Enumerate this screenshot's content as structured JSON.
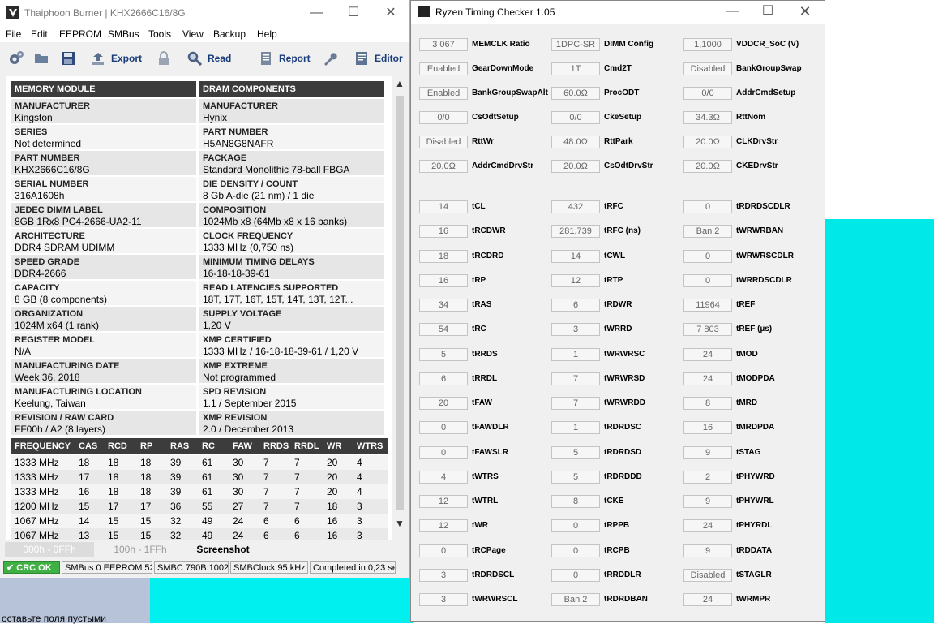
{
  "thaiphoon": {
    "title": "Thaiphoon Burner | KHX2666C16/8G",
    "menu": [
      "File",
      "Edit",
      "EEPROM",
      "SMBus",
      "Tools",
      "View",
      "Backup",
      "Help"
    ],
    "toolbar": {
      "export": "Export",
      "read": "Read",
      "report": "Report",
      "editor": "Editor"
    },
    "headers": {
      "left": "MEMORY MODULE",
      "right": "DRAM COMPONENTS"
    },
    "left_rows": [
      {
        "label": "MANUFACTURER",
        "value": "Kingston"
      },
      {
        "label": "SERIES",
        "value": "Not determined"
      },
      {
        "label": "PART NUMBER",
        "value": "KHX2666C16/8G"
      },
      {
        "label": "SERIAL NUMBER",
        "value": "316A1608h"
      },
      {
        "label": "JEDEC DIMM LABEL",
        "value": "8GB 1Rx8 PC4-2666-UA2-11"
      },
      {
        "label": "ARCHITECTURE",
        "value": "DDR4 SDRAM UDIMM"
      },
      {
        "label": "SPEED GRADE",
        "value": "DDR4-2666"
      },
      {
        "label": "CAPACITY",
        "value": "8 GB (8 components)"
      },
      {
        "label": "ORGANIZATION",
        "value": "1024M x64 (1 rank)"
      },
      {
        "label": "REGISTER MODEL",
        "value": "N/A"
      },
      {
        "label": "MANUFACTURING DATE",
        "value": "Week 36, 2018"
      },
      {
        "label": "MANUFACTURING LOCATION",
        "value": "Keelung, Taiwan"
      },
      {
        "label": "REVISION / RAW CARD",
        "value": "FF00h / A2 (8 layers)"
      }
    ],
    "right_rows": [
      {
        "label": "MANUFACTURER",
        "value": "Hynix"
      },
      {
        "label": "PART NUMBER",
        "value": "H5AN8G8NAFR"
      },
      {
        "label": "PACKAGE",
        "value": "Standard Monolithic 78-ball FBGA"
      },
      {
        "label": "DIE DENSITY / COUNT",
        "value": "8 Gb A-die (21 nm) / 1 die"
      },
      {
        "label": "COMPOSITION",
        "value": "1024Mb x8 (64Mb x8 x 16 banks)"
      },
      {
        "label": "CLOCK FREQUENCY",
        "value": "1333 MHz (0,750 ns)"
      },
      {
        "label": "MINIMUM TIMING DELAYS",
        "value": "16-18-18-39-61"
      },
      {
        "label": "READ LATENCIES SUPPORTED",
        "value": "18T, 17T, 16T, 15T, 14T, 13T, 12T..."
      },
      {
        "label": "SUPPLY VOLTAGE",
        "value": "1,20 V"
      },
      {
        "label": "XMP CERTIFIED",
        "value": "1333 MHz / 16-18-18-39-61 / 1,20 V"
      },
      {
        "label": "XMP EXTREME",
        "value": "Not programmed"
      },
      {
        "label": "SPD REVISION",
        "value": "1.1 / September 2015"
      },
      {
        "label": "XMP REVISION",
        "value": "2.0 / December 2013"
      }
    ],
    "freq_headers": [
      "FREQUENCY",
      "CAS",
      "RCD",
      "RP",
      "RAS",
      "RC",
      "FAW",
      "RRDS",
      "RRDL",
      "WR",
      "WTRS"
    ],
    "freq_rows": [
      [
        "1333 MHz",
        "18",
        "18",
        "18",
        "39",
        "61",
        "30",
        "7",
        "7",
        "20",
        "4"
      ],
      [
        "1333 MHz",
        "17",
        "18",
        "18",
        "39",
        "61",
        "30",
        "7",
        "7",
        "20",
        "4"
      ],
      [
        "1333 MHz",
        "16",
        "18",
        "18",
        "39",
        "61",
        "30",
        "7",
        "7",
        "20",
        "4"
      ],
      [
        "1200 MHz",
        "15",
        "17",
        "17",
        "36",
        "55",
        "27",
        "7",
        "7",
        "18",
        "3"
      ],
      [
        "1067 MHz",
        "14",
        "15",
        "15",
        "32",
        "49",
        "24",
        "6",
        "6",
        "16",
        "3"
      ],
      [
        "1067 MHz",
        "13",
        "15",
        "15",
        "32",
        "49",
        "24",
        "6",
        "6",
        "16",
        "3"
      ]
    ],
    "tabs": [
      "000h - 0FFh",
      "100h - 1FFh",
      "Screenshot"
    ],
    "status": [
      "CRC OK",
      "SMBus 0 EEPROM 52h",
      "SMBC 790B:1002",
      "SMBClock 95 kHz",
      "Completed in 0,23 sec"
    ]
  },
  "rtc": {
    "title": "Ryzen Timing Checker 1.05",
    "rows": [
      [
        {
          "v": "3 067",
          "l": "MEMCLK Ratio"
        },
        {
          "v": "1DPC-SR",
          "l": "DIMM Config"
        },
        {
          "v": "1,1000",
          "l": "VDDCR_SoC (V)"
        }
      ],
      [
        {
          "v": "Enabled",
          "l": "GearDownMode"
        },
        {
          "v": "1T",
          "l": "Cmd2T"
        },
        {
          "v": "Disabled",
          "l": "BankGroupSwap"
        }
      ],
      [
        {
          "v": "Enabled",
          "l": "BankGroupSwapAlt"
        },
        {
          "v": "60.0Ω",
          "l": "ProcODT"
        },
        {
          "v": "0/0",
          "l": "AddrCmdSetup"
        }
      ],
      [
        {
          "v": "0/0",
          "l": "CsOdtSetup"
        },
        {
          "v": "0/0",
          "l": "CkeSetup"
        },
        {
          "v": "34.3Ω",
          "l": "RttNom"
        }
      ],
      [
        {
          "v": "Disabled",
          "l": "RttWr"
        },
        {
          "v": "48.0Ω",
          "l": "RttPark"
        },
        {
          "v": "20.0Ω",
          "l": "CLKDrvStr"
        }
      ],
      [
        {
          "v": "20.0Ω",
          "l": "AddrCmdDrvStr"
        },
        {
          "v": "20.0Ω",
          "l": "CsOdtDrvStr"
        },
        {
          "v": "20.0Ω",
          "l": "CKEDrvStr"
        }
      ],
      [
        {
          "v": "14",
          "l": "tCL"
        },
        {
          "v": "432",
          "l": "tRFC"
        },
        {
          "v": "0",
          "l": "tRDRDSCDLR"
        }
      ],
      [
        {
          "v": "16",
          "l": "tRCDWR"
        },
        {
          "v": "281,739",
          "l": "tRFC (ns)"
        },
        {
          "v": "Ban 2",
          "l": "tWRWRBAN"
        }
      ],
      [
        {
          "v": "18",
          "l": "tRCDRD"
        },
        {
          "v": "14",
          "l": "tCWL"
        },
        {
          "v": "0",
          "l": "tWRWRSCDLR"
        }
      ],
      [
        {
          "v": "16",
          "l": "tRP"
        },
        {
          "v": "12",
          "l": "tRTP"
        },
        {
          "v": "0",
          "l": "tWRRDSCDLR"
        }
      ],
      [
        {
          "v": "34",
          "l": "tRAS"
        },
        {
          "v": "6",
          "l": "tRDWR"
        },
        {
          "v": "11964",
          "l": "tREF"
        }
      ],
      [
        {
          "v": "54",
          "l": "tRC"
        },
        {
          "v": "3",
          "l": "tWRRD"
        },
        {
          "v": "7 803",
          "l": "tREF (µs)"
        }
      ],
      [
        {
          "v": "5",
          "l": "tRRDS"
        },
        {
          "v": "1",
          "l": "tWRWRSC"
        },
        {
          "v": "24",
          "l": "tMOD"
        }
      ],
      [
        {
          "v": "6",
          "l": "tRRDL"
        },
        {
          "v": "7",
          "l": "tWRWRSD"
        },
        {
          "v": "24",
          "l": "tMODPDA"
        }
      ],
      [
        {
          "v": "20",
          "l": "tFAW"
        },
        {
          "v": "7",
          "l": "tWRWRDD"
        },
        {
          "v": "8",
          "l": "tMRD"
        }
      ],
      [
        {
          "v": "0",
          "l": "tFAWDLR"
        },
        {
          "v": "1",
          "l": "tRDRDSC"
        },
        {
          "v": "16",
          "l": "tMRDPDA"
        }
      ],
      [
        {
          "v": "0",
          "l": "tFAWSLR"
        },
        {
          "v": "5",
          "l": "tRDRDSD"
        },
        {
          "v": "9",
          "l": "tSTAG"
        }
      ],
      [
        {
          "v": "4",
          "l": "tWTRS"
        },
        {
          "v": "5",
          "l": "tRDRDDD"
        },
        {
          "v": "2",
          "l": "tPHYWRD"
        }
      ],
      [
        {
          "v": "12",
          "l": "tWTRL"
        },
        {
          "v": "8",
          "l": "tCKE"
        },
        {
          "v": "9",
          "l": "tPHYWRL"
        }
      ],
      [
        {
          "v": "12",
          "l": "tWR"
        },
        {
          "v": "0",
          "l": "tRPPB"
        },
        {
          "v": "24",
          "l": "tPHYRDL"
        }
      ],
      [
        {
          "v": "0",
          "l": "tRCPage"
        },
        {
          "v": "0",
          "l": "tRCPB"
        },
        {
          "v": "9",
          "l": "tRDDATA"
        }
      ],
      [
        {
          "v": "3",
          "l": "tRDRDSCL"
        },
        {
          "v": "0",
          "l": "tRRDDLR"
        },
        {
          "v": "Disabled",
          "l": "tSTAGLR"
        }
      ],
      [
        {
          "v": "3",
          "l": "tWRWRSCL"
        },
        {
          "v": "Ban 2",
          "l": "tRDRDBAN"
        },
        {
          "v": "24",
          "l": "tWRMPR"
        }
      ]
    ]
  },
  "background": {
    "text": "оставьте поля пустыми"
  }
}
